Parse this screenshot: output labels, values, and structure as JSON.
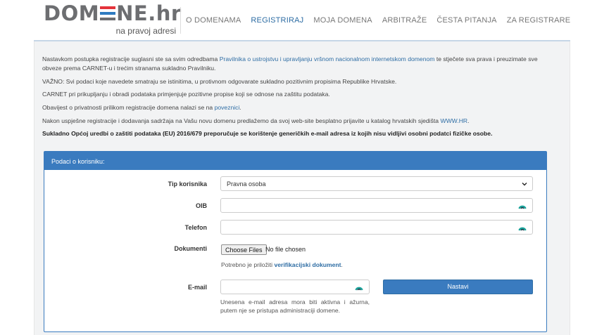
{
  "logo": {
    "main_left": "DOM",
    "main_right": "NE",
    "tld": ".hr",
    "tagline": "na pravoj adresi"
  },
  "nav": [
    {
      "label": "O DOMENAMA",
      "active": false
    },
    {
      "label": "REGISTRIRAJ",
      "active": true
    },
    {
      "label": "MOJA DOMENA",
      "active": false
    },
    {
      "label": "ARBITRAŽE",
      "active": false
    },
    {
      "label": "ČESTA PITANJA",
      "active": false
    },
    {
      "label": "ZA REGISTRARE",
      "active": false
    }
  ],
  "intro": {
    "p1_before": "Nastavkom postupka registracije suglasni ste sa svim odredbama ",
    "p1_link": "Pravilnika o ustrojstvu i upravljanju vršnom nacionalnom internetskom domenom",
    "p1_after": " te stječete sva prava i preuzimate sve obveze prema CARNET-u i trećim stranama sukladno Pravilniku.",
    "p2": "VAŽNO: Svi podaci koje navedete smatraju se istinitima, u protivnom odgovarate sukladno pozitivnim propisima Republike Hrvatske.",
    "p3": "CARNET pri prikupljanju i obradi podataka primjenjuje pozitivne propise koji se odnose na zaštitu podataka.",
    "p4_before": "Obavijest o privatnosti prilikom registracije domena nalazi se na ",
    "p4_link": "poveznici",
    "p4_after": ".",
    "p5_before": "Nakon uspješne registracije i dodavanja sadržaja na Vašu novu domenu predlažemo da svoj web-site besplatno prijavite u katalog hrvatskih sjedišta ",
    "p5_link": "WWW.HR",
    "p5_after": ".",
    "p6": "Sukladno Općoj uredbi o zaštiti podataka (EU) 2016/679 preporučuje se korištenje generičkih e-mail adresa iz kojih nisu vidljivi osobni podatci fizičke osobe."
  },
  "form": {
    "panel_title": "Podaci o korisniku:",
    "user_type_label": "Tip korisnika",
    "user_type_value": "Pravna osoba",
    "oib_label": "OIB",
    "oib_value": "",
    "phone_label": "Telefon",
    "phone_value": "",
    "documents_label": "Dokumenti",
    "file_button": "Choose Files",
    "file_status": "No file chosen",
    "documents_hint_before": "Potrebno je priložiti ",
    "documents_hint_link": "verifikacijski dokument",
    "documents_hint_after": ".",
    "email_label": "E-mail",
    "email_value": "",
    "email_hint": "Unesena e-mail adresa mora biti aktivna i ažurna, putem nje se pristupa administraciji domene.",
    "submit_label": "Nastavi"
  },
  "icons": {
    "select_chevron": "chevron-down-icon",
    "field_badge": "password-manager-icon"
  },
  "colors": {
    "accent": "#3a7bbf",
    "link": "#2e6da4",
    "logo_red": "#e4323a",
    "logo_blue": "#2e7bc0",
    "logo_gray": "#6d6e71",
    "badge_teal": "#1aa39a"
  }
}
